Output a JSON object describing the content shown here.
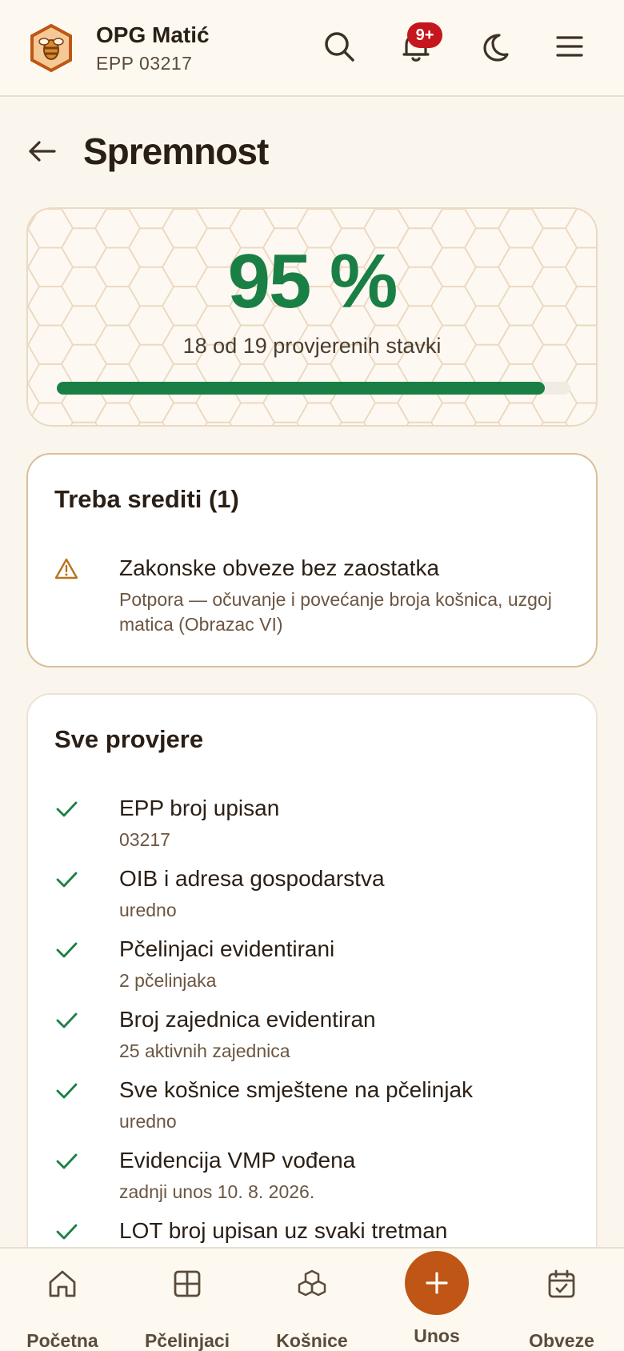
{
  "header": {
    "org_name": "OPG Matić",
    "org_sub": "EPP 03217",
    "notifications_badge": "9+"
  },
  "page": {
    "title": "Spremnost"
  },
  "score": {
    "percent_label": "95 %",
    "summary": "18 od 19 provjerenih stavki",
    "progress": 0.95
  },
  "todo": {
    "title": "Treba srediti (1)",
    "items": [
      {
        "title": "Zakonske obveze bez zaostatka",
        "detail": "Potpora — očuvanje i povećanje broja košnica, uzgoj matica (Obrazac VI)"
      }
    ]
  },
  "checks": {
    "title": "Sve provjere",
    "items": [
      {
        "title": "EPP broj upisan",
        "detail": "03217"
      },
      {
        "title": "OIB i adresa gospodarstva",
        "detail": "uredno"
      },
      {
        "title": "Pčelinjaci evidentirani",
        "detail": "2 pčelinjaka"
      },
      {
        "title": "Broj zajednica evidentiran",
        "detail": "25 aktivnih zajednica"
      },
      {
        "title": "Sve košnice smještene na pčelinjak",
        "detail": "uredno"
      },
      {
        "title": "Evidencija VMP vođena",
        "detail": "zadnji unos 10. 8. 2026."
      },
      {
        "title": "LOT broj upisan uz svaki tretman",
        "detail": ""
      }
    ]
  },
  "nav": {
    "home": "Početna",
    "apiaries": "Pčelinjaci",
    "hives": "Košnice",
    "add": "Unos",
    "duties": "Obveze"
  },
  "colors": {
    "accent_green": "#1a7f45",
    "brand_orange": "#bf5615",
    "badge_red": "#c4161c",
    "warning_amber": "#b8741a"
  }
}
